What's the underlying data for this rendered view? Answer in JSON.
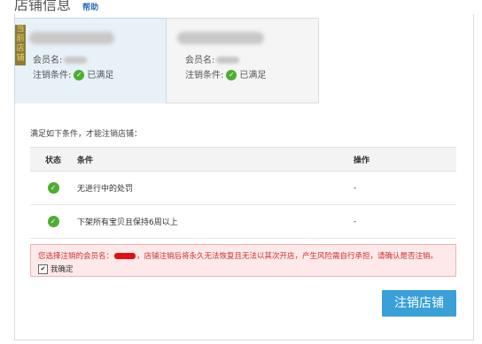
{
  "header": {
    "title": "店铺信息",
    "help": "帮助"
  },
  "cards": [
    {
      "badge": "当前店铺",
      "member_label": "会员名:",
      "condition_label": "注销条件:",
      "condition_value": "已满足"
    },
    {
      "member_label": "会员名:",
      "condition_label": "注销条件:",
      "condition_value": "已满足"
    }
  ],
  "intro": "满足如下条件，才能注销店铺：",
  "table": {
    "headers": [
      "状态",
      "条件",
      "操作"
    ],
    "rows": [
      {
        "condition": "无进行中的处罚",
        "action": "-"
      },
      {
        "condition": "下架所有宝贝且保持6周以上",
        "action": "-"
      }
    ]
  },
  "warning": {
    "prefix": "您选择注销的会员名：",
    "suffix": "，店铺注销后将永久无法恢复且无法以其次开店，产生风险需自行承担，请确认是否注销。",
    "confirm_label": "我确定"
  },
  "submit_label": "注销店铺",
  "colors": {
    "accent": "#3aa0d8",
    "success": "#4caf2f",
    "warning_text": "#d03030",
    "warning_bg": "#fde9e9"
  }
}
